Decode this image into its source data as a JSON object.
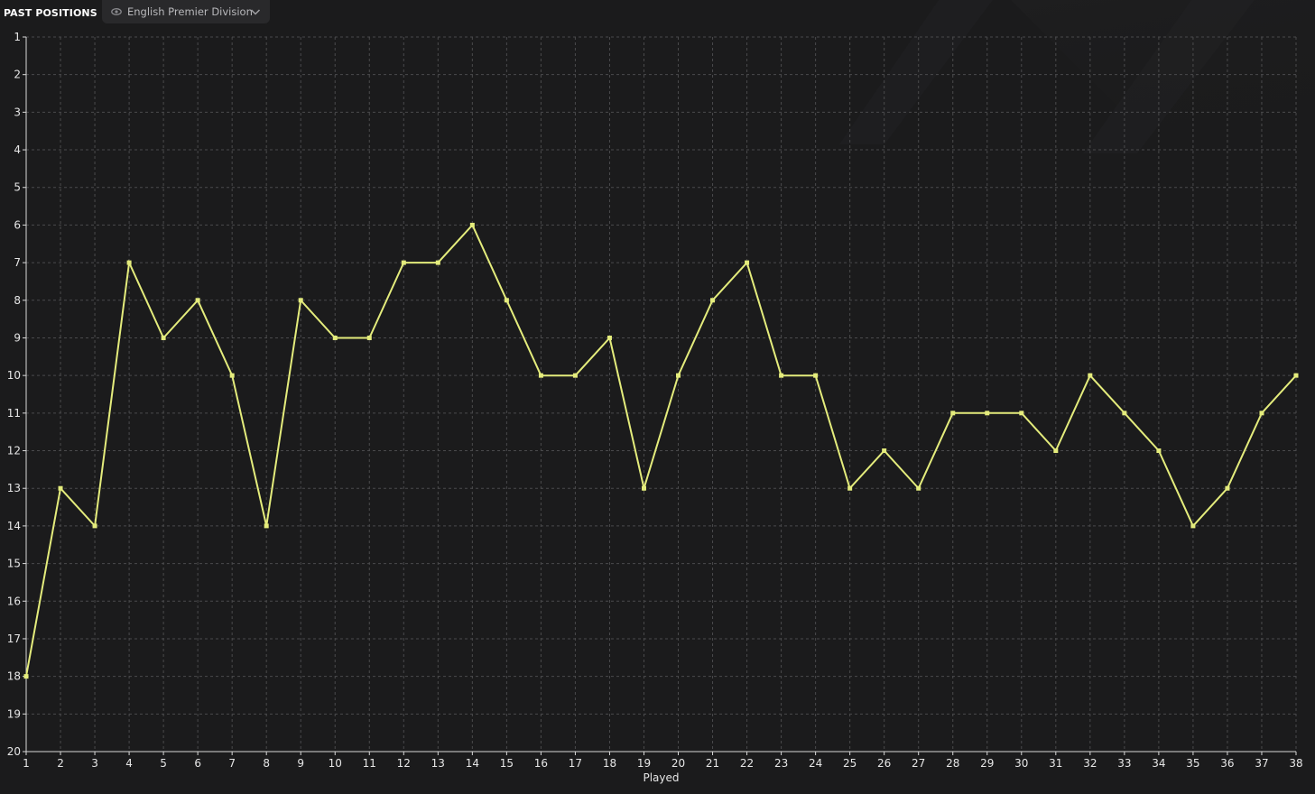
{
  "panel": {
    "title": "PAST POSITIONS"
  },
  "division_selector": {
    "label": "English Premier Division",
    "icon": "eye-icon",
    "dropdown_icon": "chevron-down-icon"
  },
  "colors": {
    "background": "#1b1b1c",
    "line": "#e4ec7c",
    "grid": "#4a4a4c",
    "text": "#e6e6e6"
  },
  "chart_data": {
    "type": "line",
    "title": "",
    "xlabel": "Played",
    "ylabel": "",
    "x": [
      1,
      2,
      3,
      4,
      5,
      6,
      7,
      8,
      9,
      10,
      11,
      12,
      13,
      14,
      15,
      16,
      17,
      18,
      19,
      20,
      21,
      22,
      23,
      24,
      25,
      26,
      27,
      28,
      29,
      30,
      31,
      32,
      33,
      34,
      35,
      36,
      37,
      38
    ],
    "series": [
      {
        "values": [
          18,
          13,
          14,
          7,
          9,
          8,
          10,
          14,
          8,
          9,
          9,
          7,
          7,
          6,
          8,
          10,
          10,
          9,
          13,
          10,
          8,
          7,
          10,
          10,
          13,
          12,
          13,
          11,
          11,
          11,
          12,
          10,
          11,
          12,
          14,
          13,
          11,
          10
        ]
      }
    ],
    "xlim": [
      1,
      38
    ],
    "ylim": [
      1,
      20
    ],
    "y_inverted": true,
    "x_ticks": [
      1,
      2,
      3,
      4,
      5,
      6,
      7,
      8,
      9,
      10,
      11,
      12,
      13,
      14,
      15,
      16,
      17,
      18,
      19,
      20,
      21,
      22,
      23,
      24,
      25,
      26,
      27,
      28,
      29,
      30,
      31,
      32,
      33,
      34,
      35,
      36,
      37,
      38
    ],
    "y_ticks": [
      1,
      2,
      3,
      4,
      5,
      6,
      7,
      8,
      9,
      10,
      11,
      12,
      13,
      14,
      15,
      16,
      17,
      18,
      19,
      20
    ],
    "grid": true,
    "legend": "none"
  }
}
